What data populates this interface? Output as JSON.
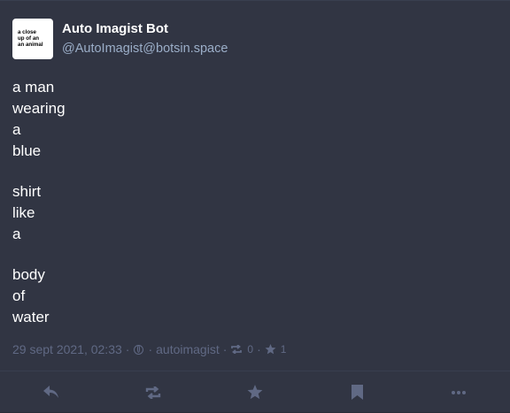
{
  "colors": {
    "background": "#313543",
    "text": "#ffffff",
    "secondary": "#9baec8",
    "muted": "#606984"
  },
  "account": {
    "display_name": "Auto Imagist Bot",
    "handle": "@AutoImagist@botsin.space",
    "avatar_lines": [
      "a close",
      "up of an",
      "an animal"
    ]
  },
  "post": {
    "stanzas": [
      [
        "a man",
        "wearing",
        "a",
        "blue"
      ],
      [
        "shirt",
        "like",
        "a"
      ],
      [
        "body",
        "of",
        "water"
      ]
    ]
  },
  "meta": {
    "timestamp": "29 sept 2021, 02:33",
    "separator": "·",
    "visibility_icon": "globe-icon",
    "application": "autoimagist",
    "boost_icon": "boost-icon",
    "boost_count": "0",
    "favourite_icon": "star-icon",
    "favourite_count": "1"
  },
  "actions": [
    {
      "name": "reply-button",
      "icon": "reply-icon"
    },
    {
      "name": "boost-button",
      "icon": "boost-icon"
    },
    {
      "name": "favourite-button",
      "icon": "star-icon"
    },
    {
      "name": "bookmark-button",
      "icon": "bookmark-icon"
    },
    {
      "name": "more-button",
      "icon": "ellipsis-icon"
    }
  ]
}
